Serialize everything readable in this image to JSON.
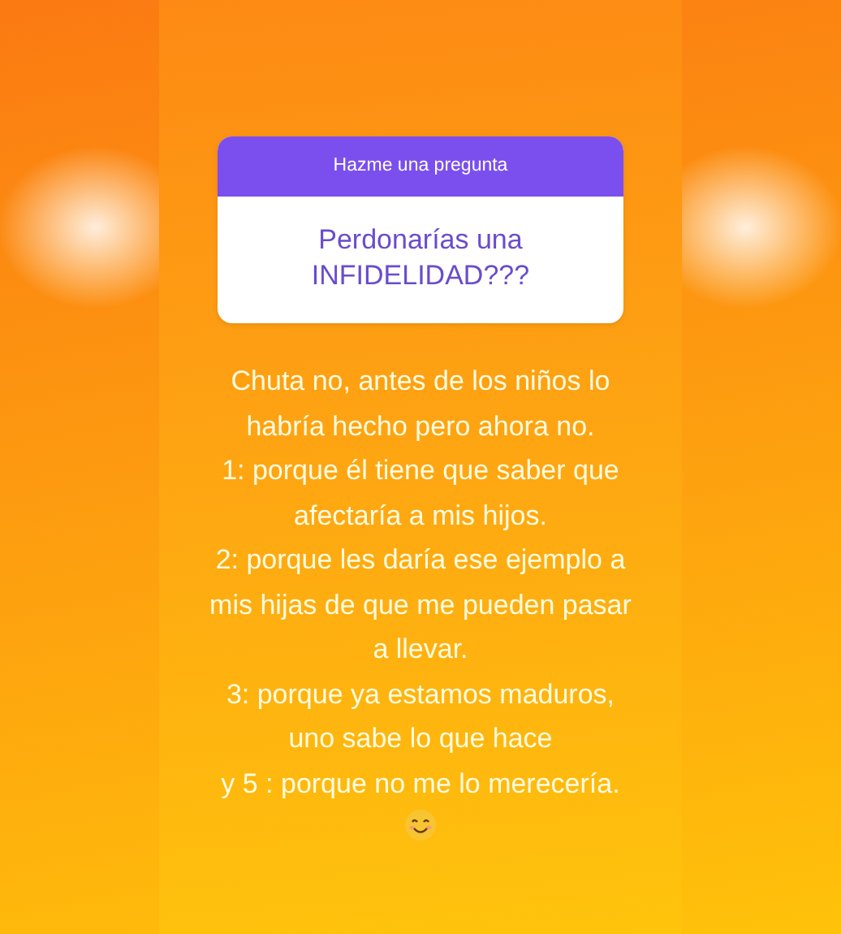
{
  "question_sticker": {
    "header": "Hazme una pregunta",
    "question": "Perdonarías una INFIDELIDAD???"
  },
  "answer_lines": [
    "Chuta no, antes de los niños lo",
    "habría hecho pero ahora no.",
    "1: porque él tiene que saber que",
    "afectaría a mis hijos.",
    "2: porque les daría ese ejemplo a",
    "mis hijas de que me pueden pasar",
    "a llevar.",
    "3: porque ya estamos maduros,",
    "uno sabe lo que hace",
    "y 5 : porque no me lo merecería."
  ]
}
